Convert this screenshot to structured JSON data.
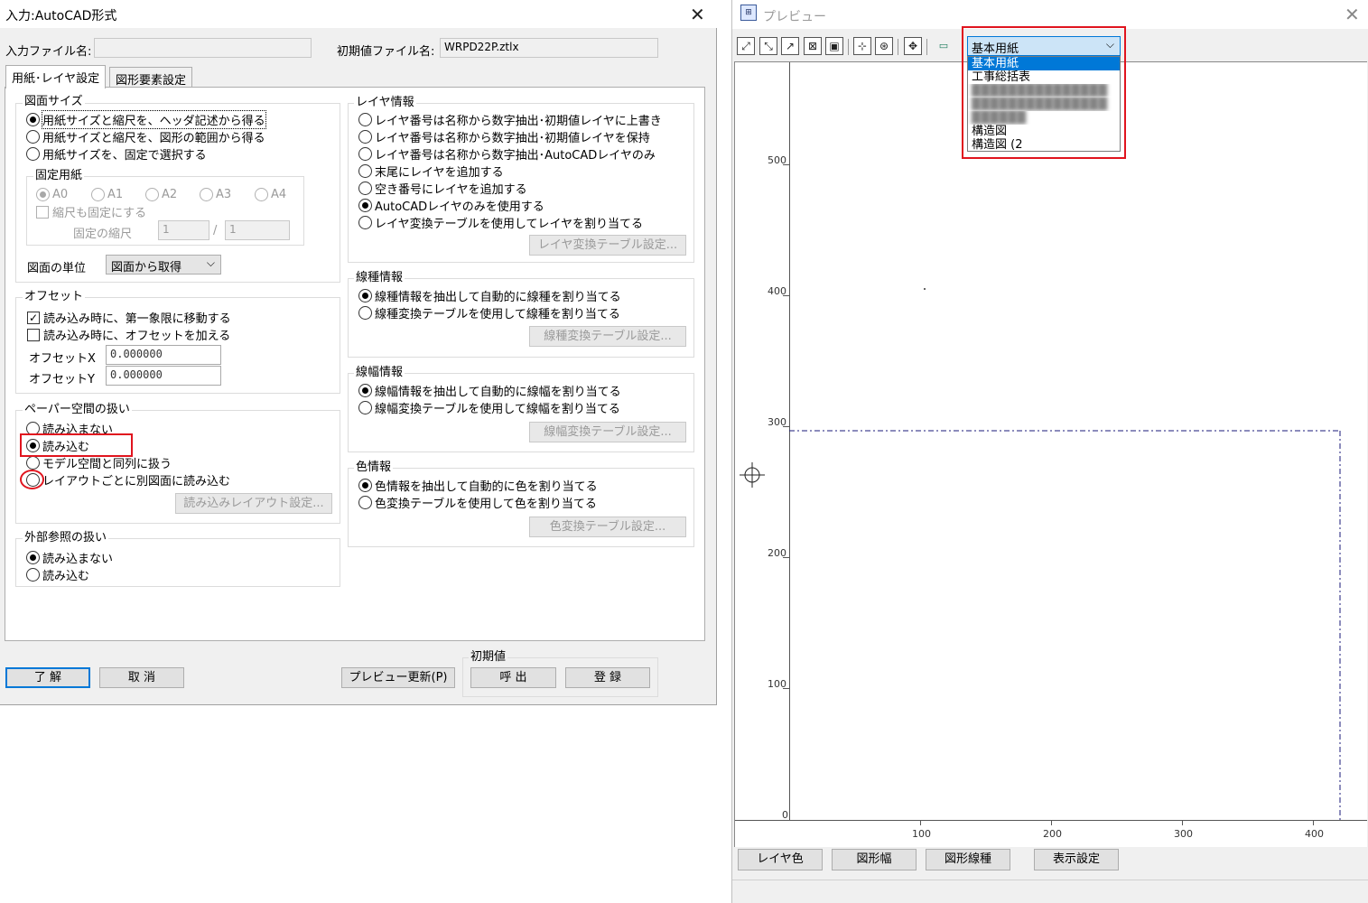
{
  "dialog": {
    "title": "入力:AutoCAD形式",
    "input_file_label": "入力ファイル名:",
    "input_file_value": "",
    "init_file_label": "初期値ファイル名:",
    "init_file_value": "WRPD22P.ztlx",
    "tabs": [
      "用紙･レイヤ設定",
      "図形要素設定"
    ],
    "paper_size": {
      "title": "図面サイズ",
      "options": [
        "用紙サイズと縮尺を、ヘッダ記述から得る",
        "用紙サイズと縮尺を、図形の範囲から得る",
        "用紙サイズを、固定で選択する"
      ],
      "selected": 0,
      "fixed_paper": {
        "title": "固定用紙",
        "sizes": [
          "A0",
          "A1",
          "A2",
          "A3",
          "A4"
        ],
        "selected": 0,
        "fix_scale_label": "縮尺も固定にする",
        "fixed_scale_label": "固定の縮尺",
        "scale_num": "1",
        "scale_sep": "/",
        "scale_den": "1"
      },
      "unit_label": "図面の単位",
      "unit_value": "図面から取得"
    },
    "offset": {
      "title": "オフセット",
      "move_first_quadrant": "読み込み時に、第一象限に移動する",
      "move_checked": true,
      "add_offset": "読み込み時に、オフセットを加える",
      "add_checked": false,
      "x_label": "オフセットX",
      "x_value": "0.000000",
      "y_label": "オフセットY",
      "y_value": "0.000000"
    },
    "paper_space": {
      "title": "ペーパー空間の扱い",
      "options": [
        "読み込まない",
        "読み込む",
        "モデル空間と同列に扱う",
        "レイアウトごとに別図面に読み込む"
      ],
      "selected": 1,
      "button": "読み込みレイアウト設定..."
    },
    "xref": {
      "title": "外部参照の扱い",
      "options": [
        "読み込まない",
        "読み込む"
      ],
      "selected": 0
    },
    "layer": {
      "title": "レイヤ情報",
      "options": [
        "レイヤ番号は名称から数字抽出･初期値レイヤに上書き",
        "レイヤ番号は名称から数字抽出･初期値レイヤを保持",
        "レイヤ番号は名称から数字抽出･AutoCADレイヤのみ",
        "末尾にレイヤを追加する",
        "空き番号にレイヤを追加する",
        "AutoCADレイヤのみを使用する",
        "レイヤ変換テーブルを使用してレイヤを割り当てる"
      ],
      "selected": 5,
      "button": "レイヤ変換テーブル設定..."
    },
    "linetype": {
      "title": "線種情報",
      "options": [
        "線種情報を抽出して自動的に線種を割り当てる",
        "線種変換テーブルを使用して線種を割り当てる"
      ],
      "selected": 0,
      "button": "線種変換テーブル設定..."
    },
    "linewidth": {
      "title": "線幅情報",
      "options": [
        "線幅情報を抽出して自動的に線幅を割り当てる",
        "線幅変換テーブルを使用して線幅を割り当てる"
      ],
      "selected": 0,
      "button": "線幅変換テーブル設定..."
    },
    "color": {
      "title": "色情報",
      "options": [
        "色情報を抽出して自動的に色を割り当てる",
        "色変換テーブルを使用して色を割り当てる"
      ],
      "selected": 0,
      "button": "色変換テーブル設定..."
    },
    "footer": {
      "ok": "了 解",
      "cancel": "取 消",
      "preview_update": "プレビュー更新(P)",
      "init_title": "初期値",
      "recall": "呼 出",
      "register": "登 録"
    }
  },
  "preview": {
    "title": "プレビュー",
    "dropdown_selected": "基本用紙",
    "dropdown_items": [
      "基本用紙",
      "工事総括表",
      "",
      "",
      "",
      "構造図",
      "構造図 (2"
    ],
    "y_ticks": [
      "500",
      "400",
      "300",
      "200",
      "100",
      "0"
    ],
    "x_ticks": [
      "100",
      "200",
      "300",
      "400"
    ],
    "bottom_buttons": [
      "レイヤ色",
      "図形幅",
      "図形線種",
      "表示設定"
    ],
    "colors": {
      "accent": "#0078d7",
      "highlight": "#e0141e",
      "paper_frame": "#1a1a7a"
    }
  }
}
